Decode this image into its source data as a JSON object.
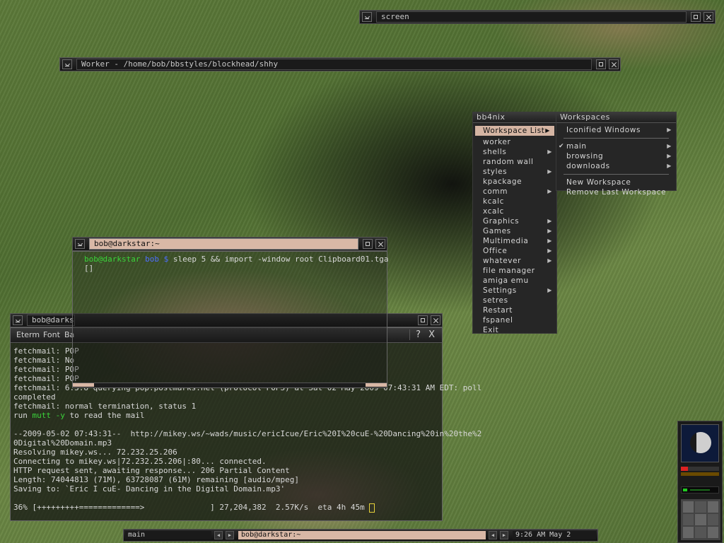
{
  "screen_window": {
    "title": "screen"
  },
  "worker_window": {
    "title": "Worker - /home/bob/bbstyles/blockhead/shhy"
  },
  "term1": {
    "title": "bob@darkstar:~",
    "prompt_user": "bob@darkstar",
    "prompt_dir": "bob $",
    "command": "sleep 5 && import -window root Clipboard01.tga",
    "cursor": "[]"
  },
  "term2": {
    "title": "bob@darks",
    "menu": [
      "Eterm",
      "Font",
      "Ba"
    ],
    "menu_right": [
      "?",
      "X"
    ],
    "lines": [
      "fetchmail: POP",
      "fetchmail: No",
      "fetchmail: POP",
      "fetchmail: POP",
      "fetchmail: 6.3.8 querying pop.postmarks.net (protocol POP3) at Sat 02 May 2009 07:43:31 AM EDT: poll",
      "completed",
      "fetchmail: normal termination, status 1",
      "",
      "",
      "--2009-05-02 07:43:31--  http://mikey.ws/~wads/music/ericIcue/Eric%20I%20cuE-%20Dancing%20in%20the%2",
      "0Digital%20Domain.mp3",
      "Resolving mikey.ws... 72.232.25.206",
      "Connecting to mikey.ws|72.232.25.206|:80... connected.",
      "HTTP request sent, awaiting response... 206 Partial Content",
      "Length: 74044813 (71M), 63728087 (61M) remaining [audio/mpeg]",
      "Saving to: `Eric I cuE- Dancing in the Digital Domain.mp3'"
    ],
    "mutt_prefix": "run ",
    "mutt_cmd": "mutt -y",
    "mutt_suffix": " to read the mail",
    "progress": "36% [+++++++++=============>              ] 27,204,382  2.57K/s  eta 4h 45m",
    "progress_fraction": 0.36
  },
  "rootmenu": {
    "title": "bb4nix",
    "items": [
      {
        "label": "Workspace List",
        "sub": true,
        "selected": true
      },
      {
        "label": "worker",
        "sub": false
      },
      {
        "label": "shells",
        "sub": true
      },
      {
        "label": "random wall",
        "sub": false
      },
      {
        "label": "styles",
        "sub": true
      },
      {
        "label": "kpackage",
        "sub": false
      },
      {
        "label": "comm",
        "sub": true
      },
      {
        "label": "kcalc",
        "sub": false
      },
      {
        "label": "xcalc",
        "sub": false
      },
      {
        "label": "Graphics",
        "sub": true
      },
      {
        "label": "Games",
        "sub": true
      },
      {
        "label": "Multimedia",
        "sub": true
      },
      {
        "label": "Office",
        "sub": true
      },
      {
        "label": "whatever",
        "sub": true
      },
      {
        "label": "file manager",
        "sub": false
      },
      {
        "label": "amiga emu",
        "sub": false
      },
      {
        "label": "Settings",
        "sub": true
      },
      {
        "label": "setres",
        "sub": false
      },
      {
        "label": "Restart",
        "sub": false
      },
      {
        "label": "fspanel",
        "sub": false
      },
      {
        "label": "Exit",
        "sub": false
      }
    ]
  },
  "workspaces_menu": {
    "title": "Workspaces",
    "iconified": "Iconified Windows",
    "workspaces": [
      {
        "label": "main",
        "checked": true
      },
      {
        "label": "browsing",
        "checked": false
      },
      {
        "label": "downloads",
        "checked": false
      }
    ],
    "new_ws": "New Workspace",
    "remove_ws": "Remove Last Workspace"
  },
  "toolbar": {
    "workspace": "main",
    "window": "bob@darkstar:~",
    "clock": "9:26 AM  May  2"
  },
  "colors": {
    "accent": "#d9b8a6",
    "prompt_green": "#3ad33a",
    "prompt_blue": "#4d6dff"
  }
}
